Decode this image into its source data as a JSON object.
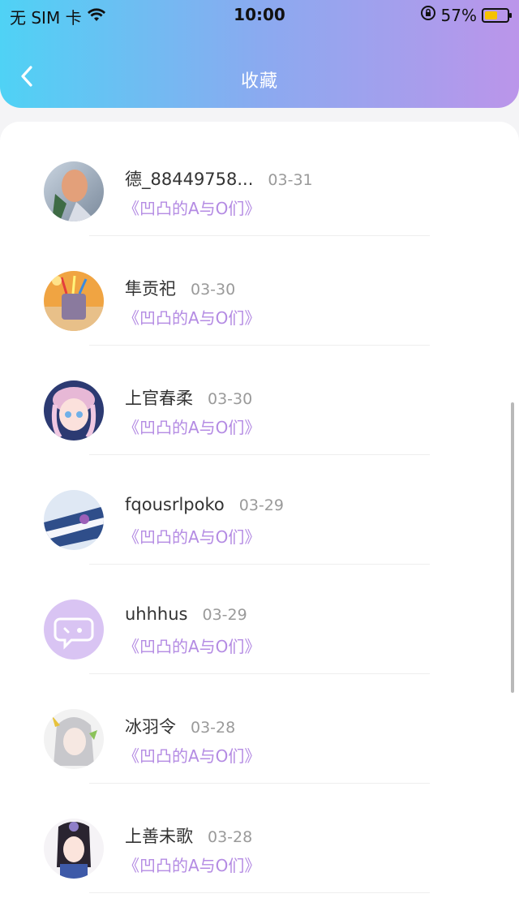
{
  "status_bar": {
    "carrier": "无 SIM 卡",
    "time": "10:00",
    "battery": "57%",
    "battery_level": 0.57
  },
  "header": {
    "title": "收藏"
  },
  "favorites": [
    {
      "user": "德_88449758...",
      "date": "03-31",
      "book": "《凹凸的A与O们》",
      "avatar": "avatar-portrait-warm"
    },
    {
      "user": "隼贡祀",
      "date": "03-30",
      "book": "《凹凸的A与O们》",
      "avatar": "avatar-pencil-cup"
    },
    {
      "user": "上官春柔",
      "date": "03-30",
      "book": "《凹凸的A与O们》",
      "avatar": "avatar-anime-girl"
    },
    {
      "user": "fqousrlpoko",
      "date": "03-29",
      "book": "《凹凸的A与O们》",
      "avatar": "avatar-piano"
    },
    {
      "user": "uhhhus",
      "date": "03-29",
      "book": "《凹凸的A与O们》",
      "avatar": "avatar-default-chat"
    },
    {
      "user": "冰羽令",
      "date": "03-28",
      "book": "《凹凸的A与O们》",
      "avatar": "avatar-silver-hair"
    },
    {
      "user": "上善未歌",
      "date": "03-28",
      "book": "《凹凸的A与O们》",
      "avatar": "avatar-ancient-girl"
    }
  ],
  "colors": {
    "gradient_start": "#4fd2f5",
    "gradient_end": "#bb95ea",
    "book_title": "#b48be3"
  }
}
